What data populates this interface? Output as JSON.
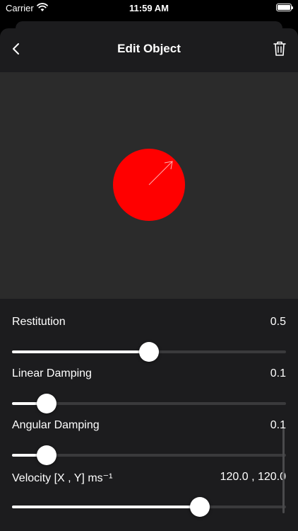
{
  "status_bar": {
    "carrier": "Carrier",
    "time": "11:59 AM",
    "battery_level": 1.0
  },
  "nav": {
    "title": "Edit Object",
    "back_icon": "chevron-left-icon",
    "delete_icon": "trash-icon"
  },
  "object": {
    "shape": "circle",
    "color": "#ff0000",
    "velocity_arrow": true
  },
  "controls": [
    {
      "label": "Restitution",
      "value": "0.5",
      "slider_fraction": 0.5
    },
    {
      "label": "Linear Damping",
      "value": "0.1",
      "slider_fraction": 0.125
    },
    {
      "label": "Angular Damping",
      "value": "0.1",
      "slider_fraction": 0.125
    },
    {
      "label": "Velocity [X , Y] ms⁻¹",
      "value": "120.0 ,  120.0",
      "slider_fraction": 0.685
    }
  ],
  "colors": {
    "background": "#000000",
    "sheet": "#1c1c1e",
    "preview": "#2b2b2b",
    "track": "#3a3a3c",
    "accent": "#ffffff"
  }
}
